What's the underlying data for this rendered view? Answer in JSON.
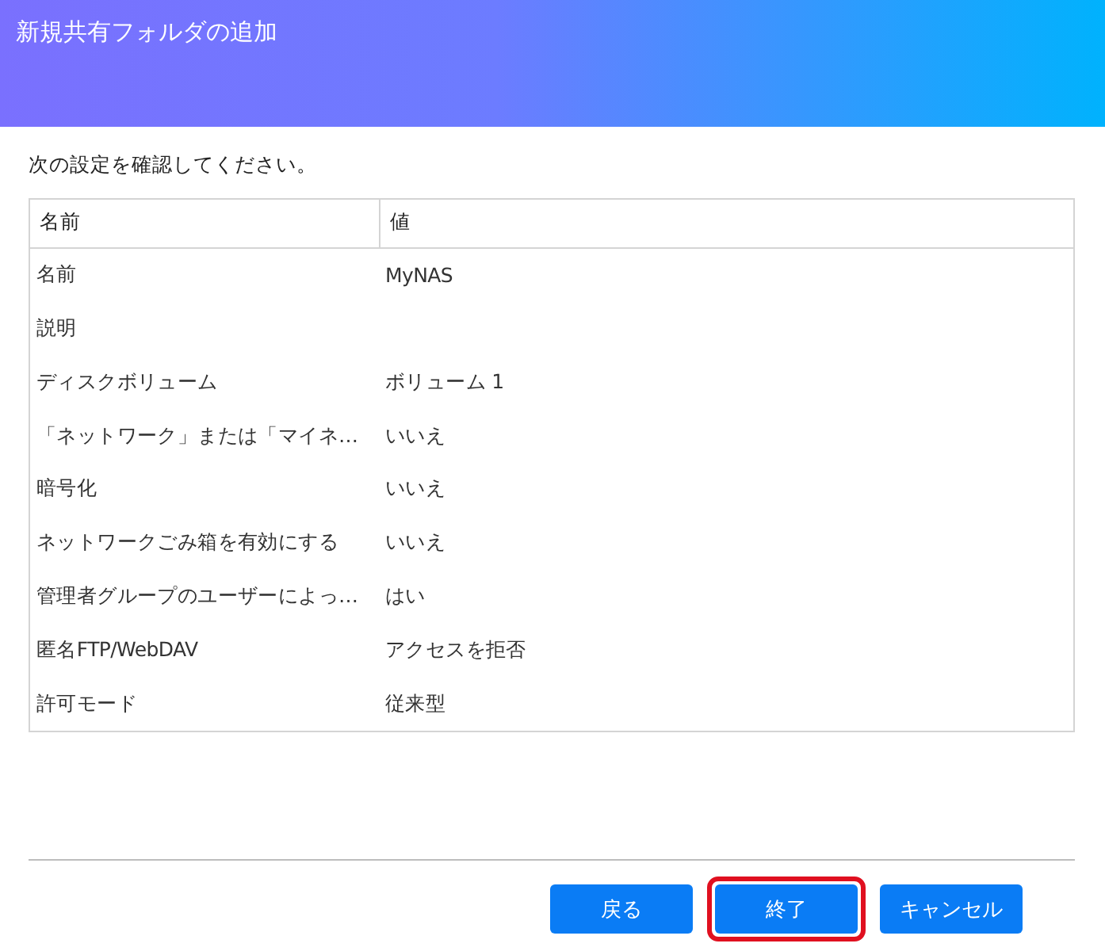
{
  "window": {
    "title": "新規共有フォルダの追加"
  },
  "instruction": "次の設定を確認してください。",
  "table": {
    "columns": [
      "名前",
      "値"
    ],
    "rows": [
      [
        "名前",
        "MyNAS"
      ],
      [
        "説明",
        ""
      ],
      [
        "ディスクボリューム",
        "ボリューム 1"
      ],
      [
        "「ネットワーク」または「マイネ…",
        "いいえ"
      ],
      [
        "暗号化",
        "いいえ"
      ],
      [
        "ネットワークごみ箱を有効にする",
        "いいえ"
      ],
      [
        "管理者グループのユーザーによっ…",
        "はい"
      ],
      [
        "匿名FTP/WebDAV",
        "アクセスを拒否"
      ],
      [
        "許可モード",
        "従来型"
      ]
    ]
  },
  "buttons": [
    {
      "label": "戻る",
      "highlighted": false
    },
    {
      "label": "終了",
      "highlighted": true
    },
    {
      "label": "キャンセル",
      "highlighted": false
    }
  ]
}
